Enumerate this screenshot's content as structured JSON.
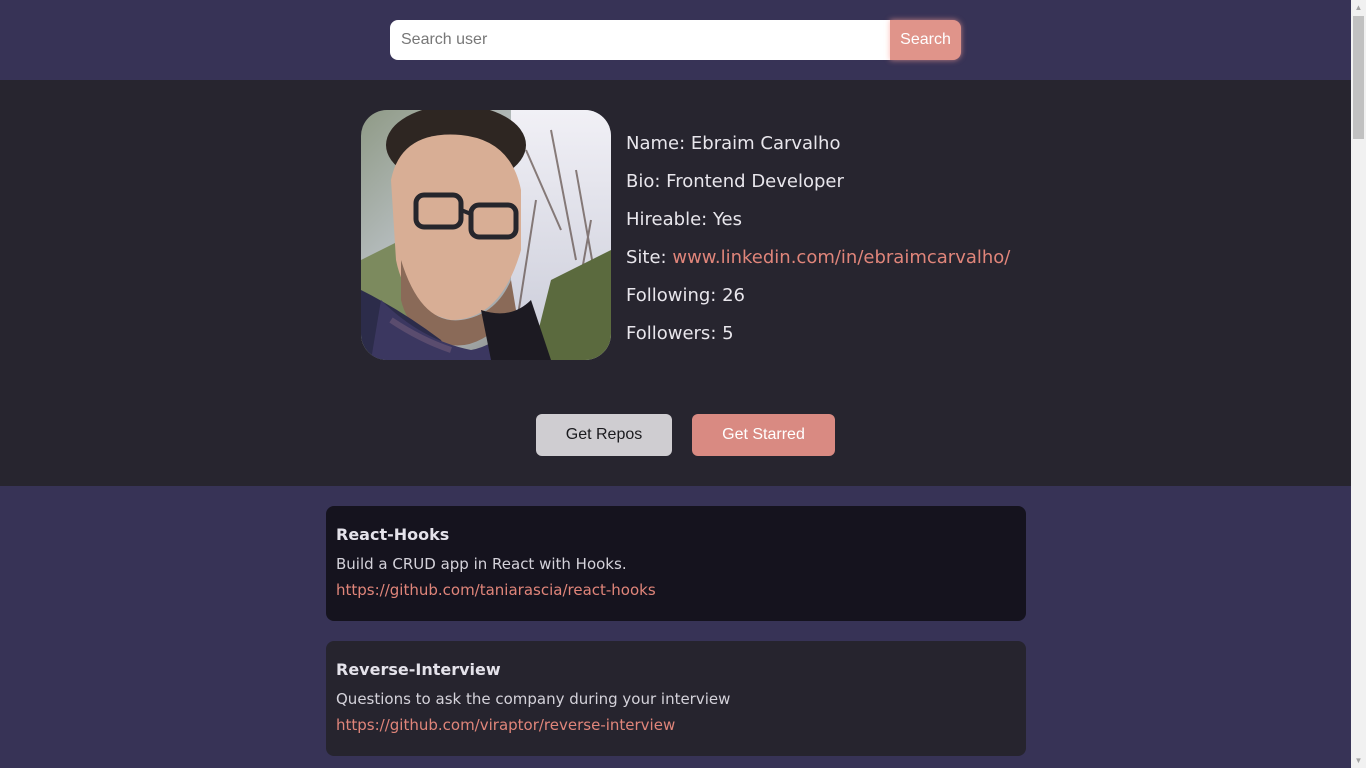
{
  "search": {
    "placeholder": "Search user",
    "button_label": "Search"
  },
  "profile": {
    "name_label": "Name: ",
    "name": "Ebraim Carvalho",
    "bio_label": "Bio: ",
    "bio": "Frontend Developer",
    "hireable_label": "Hireable: ",
    "hireable": "Yes",
    "site_label": "Site: ",
    "site": "www.linkedin.com/in/ebraimcarvalho/",
    "following_label": "Following: ",
    "following": "26",
    "followers_label": "Followers: ",
    "followers": "5"
  },
  "actions": {
    "repos_label": "Get Repos",
    "starred_label": "Get Starred"
  },
  "repos": [
    {
      "title": "React-Hooks",
      "description": "Build a CRUD app in React with Hooks.",
      "url": "https://github.com/taniarascia/react-hooks"
    },
    {
      "title": "Reverse-Interview",
      "description": "Questions to ask the company during your interview",
      "url": "https://github.com/viraptor/reverse-interview"
    }
  ],
  "colors": {
    "header_bg": "#373356",
    "profile_bg": "#27252f",
    "accent": "#e0857a",
    "card_dark": "#15131e",
    "card": "#26242e"
  }
}
